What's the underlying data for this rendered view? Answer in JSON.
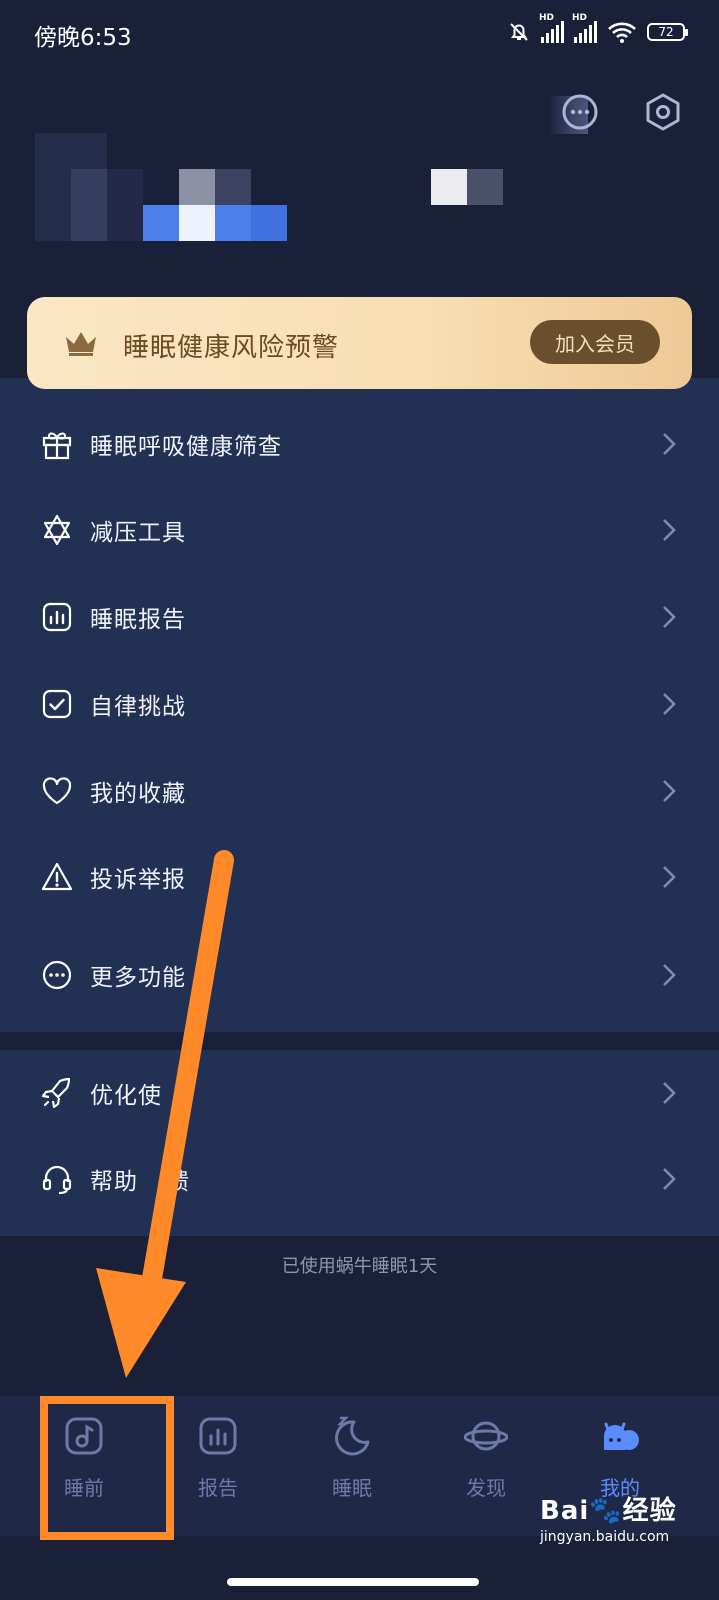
{
  "status_bar": {
    "time": "傍晚6:53",
    "battery": "72",
    "signal_label": "HD"
  },
  "vip_banner": {
    "title": "睡眠健康风险预警",
    "join_label": "加入会员"
  },
  "menu": {
    "items": [
      {
        "label": "睡眠呼吸健康筛查",
        "icon": "gift-icon"
      },
      {
        "label": "减压工具",
        "icon": "star-of-david-icon"
      },
      {
        "label": "睡眠报告",
        "icon": "chart-icon"
      },
      {
        "label": "自律挑战",
        "icon": "checkbox-icon"
      },
      {
        "label": "我的收藏",
        "icon": "heart-icon"
      },
      {
        "label": "投诉举报",
        "icon": "warning-icon"
      },
      {
        "label": "更多功能",
        "icon": "more-icon"
      }
    ],
    "items2": [
      {
        "label": "优化使",
        "icon": "rocket-icon"
      },
      {
        "label": "帮助",
        "label_tail": "馈",
        "icon": "headset-icon"
      }
    ]
  },
  "footer_note": "已使用蜗牛睡眠1天",
  "tabs": [
    {
      "label": "睡前",
      "icon": "music-note-icon"
    },
    {
      "label": "报告",
      "icon": "chart-icon"
    },
    {
      "label": "睡眠",
      "icon": "moon-icon"
    },
    {
      "label": "发现",
      "icon": "planet-icon"
    },
    {
      "label": "我的",
      "icon": "snail-icon"
    }
  ],
  "colors": {
    "background": "#1a2038",
    "card": "#223053",
    "accent": "#5b8cff",
    "highlight": "#ff8a2a",
    "vip_gold": "#f8deb2"
  },
  "watermark": {
    "brand": "Bai",
    "brand_tail": "经验",
    "url": "jingyan.baidu.com"
  }
}
